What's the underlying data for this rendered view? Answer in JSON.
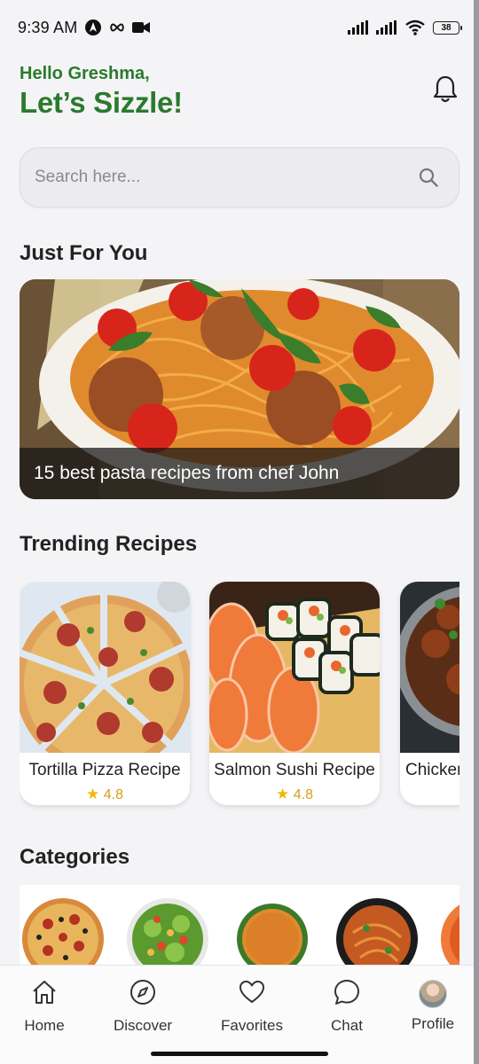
{
  "status_bar": {
    "time": "9:39 AM",
    "battery": "38"
  },
  "header": {
    "greeting": "Hello Greshma,",
    "tagline": "Let’s Sizzle!"
  },
  "search": {
    "placeholder": "Search here..."
  },
  "sections": {
    "just_for_you": "Just For You",
    "trending": "Trending Recipes",
    "categories": "Categories"
  },
  "featured": {
    "caption": "15 best pasta recipes from chef John"
  },
  "trending": [
    {
      "name": "Tortilla Pizza Recipe",
      "rating": "4.8"
    },
    {
      "name": "Salmon Sushi Recipe",
      "rating": "4.8"
    },
    {
      "name": "Chicken",
      "rating": ""
    }
  ],
  "bottom_nav": [
    {
      "label": "Home",
      "icon": "home-icon"
    },
    {
      "label": "Discover",
      "icon": "compass-icon"
    },
    {
      "label": "Favorites",
      "icon": "heart-icon"
    },
    {
      "label": "Chat",
      "icon": "chat-icon"
    },
    {
      "label": "Profile",
      "icon": "avatar"
    }
  ],
  "colors": {
    "brand_green": "#2b7a2e",
    "star": "#f2b705",
    "rating_text": "#d4a017"
  }
}
